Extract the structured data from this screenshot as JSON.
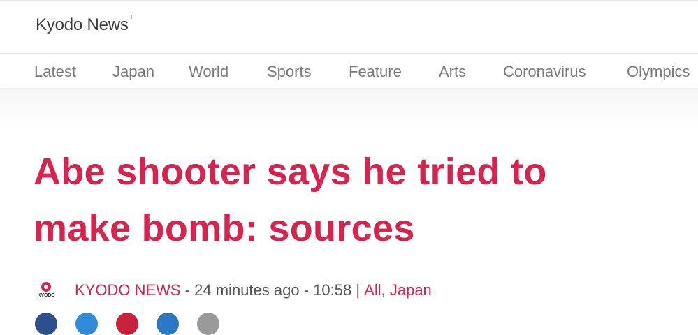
{
  "site": {
    "name": "Kyodo News",
    "name_superscript": "+"
  },
  "nav": {
    "items": [
      "Latest",
      "Japan",
      "World",
      "Sports",
      "Feature",
      "Arts",
      "Coronavirus",
      "Olympics"
    ]
  },
  "article": {
    "headline_line1": "Abe shooter says he tried to",
    "headline_line2": "make bomb: sources",
    "byline": {
      "logo_text": "KYODO",
      "source": "KYODO NEWS",
      "sep1": " - ",
      "time_ago": "24 minutes ago",
      "sep2": " - ",
      "time": "10:58",
      "pipe": " | ",
      "category1": "All",
      "comma": ", ",
      "category2": "Japan"
    }
  },
  "colors": {
    "accent": "#d6244f",
    "share_buttons": [
      "#2d4f8e",
      "#2f8bd6",
      "#c8233b",
      "#2c78c4",
      "#9a9a9a"
    ]
  }
}
